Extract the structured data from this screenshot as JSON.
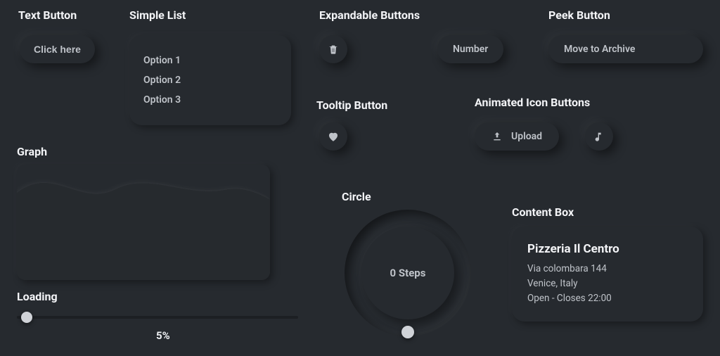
{
  "text_button": {
    "heading": "Text Button",
    "label": "Click here"
  },
  "simple_list": {
    "heading": "Simple List",
    "items": [
      "Option 1",
      "Option 2",
      "Option 3"
    ]
  },
  "expandable": {
    "heading": "Expandable Buttons",
    "trash_icon": "trash-icon",
    "number_label": "Number"
  },
  "peek": {
    "heading": "Peek Button",
    "label": "Move to Archive"
  },
  "tooltip": {
    "heading": "Tooltip Button",
    "icon": "heart-icon"
  },
  "anim_icons": {
    "heading": "Animated Icon Buttons",
    "upload_label": "Upload",
    "upload_icon": "upload-icon",
    "music_icon": "music-note-icon"
  },
  "graph": {
    "heading": "Graph"
  },
  "loading": {
    "heading": "Loading",
    "percent": "5%"
  },
  "circle": {
    "heading": "Circle",
    "label": "0 Steps"
  },
  "content_box": {
    "heading": "Content Box",
    "title": "Pizzeria Il Centro",
    "lines": [
      "Via colombara 144",
      "Venice, Italy",
      "Open - Closes 22:00"
    ]
  },
  "colors": {
    "bg": "#262a2f",
    "text": "#bfc3c9",
    "heading": "#f3f4f7",
    "knob": "#d0d3d8"
  }
}
